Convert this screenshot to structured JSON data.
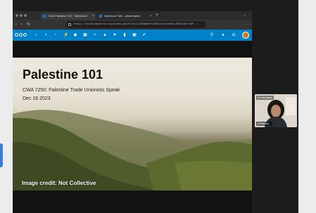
{
  "browser": {
    "tabs": [
      {
        "label": "CWA Palestine 101 · Nextcloud",
        "close": "×"
      },
      {
        "label": "Nextcloud Talk - presentation",
        "close": "×"
      }
    ],
    "new_tab": "+",
    "address": {
      "url": "https://stocm.mayfirst.org/index.php/f/call/23X8sW?hf=1&fullscreen&t=2&folder=%2F...",
      "back": "‹",
      "forward": "›",
      "reload": "↻"
    }
  },
  "app_toolbar": {
    "accent": "#0082c9",
    "icons": [
      "dashboard-icon",
      "files-icon",
      "photos-icon",
      "activity-icon",
      "talk-icon",
      "calendar-icon",
      "contacts-icon",
      "deck-icon",
      "favorites-icon",
      "notes-icon",
      "tasks-icon",
      "checklist-icon"
    ],
    "right_icons": [
      "search-icon",
      "notifications-icon",
      "contacts-menu-icon",
      "user-avatar"
    ]
  },
  "slide": {
    "title": "Palestine 101",
    "subtitle": "CWA 7250: Palestine Trade Unionists Speak",
    "date": "Dec 16 2023",
    "credit": "Image credit: Not Collective"
  },
  "participant": {
    "name": "femme garcia",
    "caption": "all that am..."
  }
}
